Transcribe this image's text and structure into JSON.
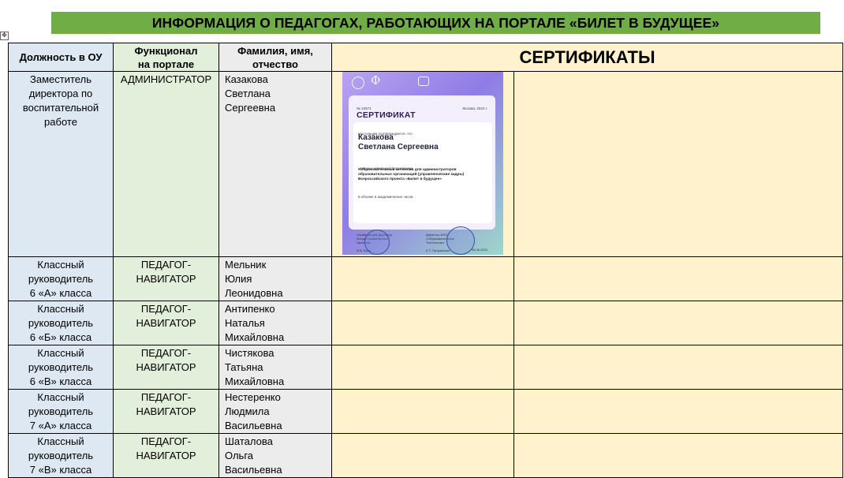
{
  "title": "ИНФОРМАЦИЯ О ПЕДАГОГАХ, РАБОТАЮЩИХ НА ПОРТАЛЕ «БИЛЕТ В БУДУЩЕЕ»",
  "move_handle": "✥",
  "headers": {
    "position": "Должность в ОУ",
    "function_l1": "Функционал",
    "function_l2": "на портале",
    "name_l1": "Фамилия, имя,",
    "name_l2": "отчество",
    "certificates": "СЕРТИФИКАТЫ"
  },
  "rows": [
    {
      "position": [
        "Заместитель",
        "директора по",
        "воспитательной",
        "работе"
      ],
      "function": [
        "АДМИНИСТРАТОР"
      ],
      "name": [
        "Казакова",
        "Светлана",
        "Сергеевна"
      ]
    },
    {
      "position": [
        "Классный",
        "руководитель",
        "6 «А» класса"
      ],
      "function": [
        "ПЕДАГОГ-",
        "НАВИГАТОР"
      ],
      "name": [
        "Мельник",
        "Юлия",
        "Леонидовна"
      ]
    },
    {
      "position": [
        "Классный",
        "руководитель",
        "6 «Б» класса"
      ],
      "function": [
        "ПЕДАГОГ-",
        "НАВИГАТОР"
      ],
      "name": [
        "Антипенко",
        "Наталья",
        "Михайловна"
      ]
    },
    {
      "position": [
        "Классный",
        "руководитель",
        "6 «В» класса"
      ],
      "function": [
        "ПЕДАГОГ-",
        "НАВИГАТОР"
      ],
      "name": [
        "Чистякова",
        "Татьяна",
        "Михайловна"
      ]
    },
    {
      "position": [
        "Классный",
        "руководитель",
        "7 «А» класса"
      ],
      "function": [
        "ПЕДАГОГ-",
        "НАВИГАТОР"
      ],
      "name": [
        "Нестеренко",
        "Людмила",
        "Васильевна"
      ]
    },
    {
      "position": [
        "Классный",
        "руководитель",
        "7 «В» класса"
      ],
      "function": [
        "ПЕДАГОГ-",
        "НАВИГАТОР"
      ],
      "name": [
        "Шаталова",
        "Ольга",
        "Васильевна"
      ]
    }
  ],
  "certificate": {
    "number": "№ 10971",
    "city_date": "Москва, 2024 г.",
    "heading": "СЕРТИФИКАТ",
    "confirms": "Настоящим подтверждается, что",
    "name_l1": "Казакова",
    "name_l2": "Светлана Сергеевна",
    "completed": "успешно завершил(а) программу",
    "program": "«Образовательный интенсив для администраторов образовательных организаций (управленческие кадры) Всероссийского проекта «Билет в будущее»",
    "hours": "в объеме 6 академических часов.",
    "sign_left_l1": "Управляющий Директор",
    "sign_left_l2": "Фонда Гуманитарных",
    "sign_left_l3": "Проектов",
    "sign_left_name": "Ф.В. Блэк",
    "sign_right_l1": "Директор АНО",
    "sign_right_l2": "«Образовательные",
    "sign_right_l3": "Технологии»",
    "sign_right_name": "Е.Т. Петровская",
    "date": "06.06.2024"
  },
  "colors": {
    "title_bg": "#70ad47",
    "col_position": "#dde8f3",
    "col_function": "#e2efda",
    "col_name": "#ececec",
    "col_cert": "#fff2cc",
    "cert_gradient_a": "#b9a3f0",
    "cert_gradient_b": "#9fd7c9"
  }
}
